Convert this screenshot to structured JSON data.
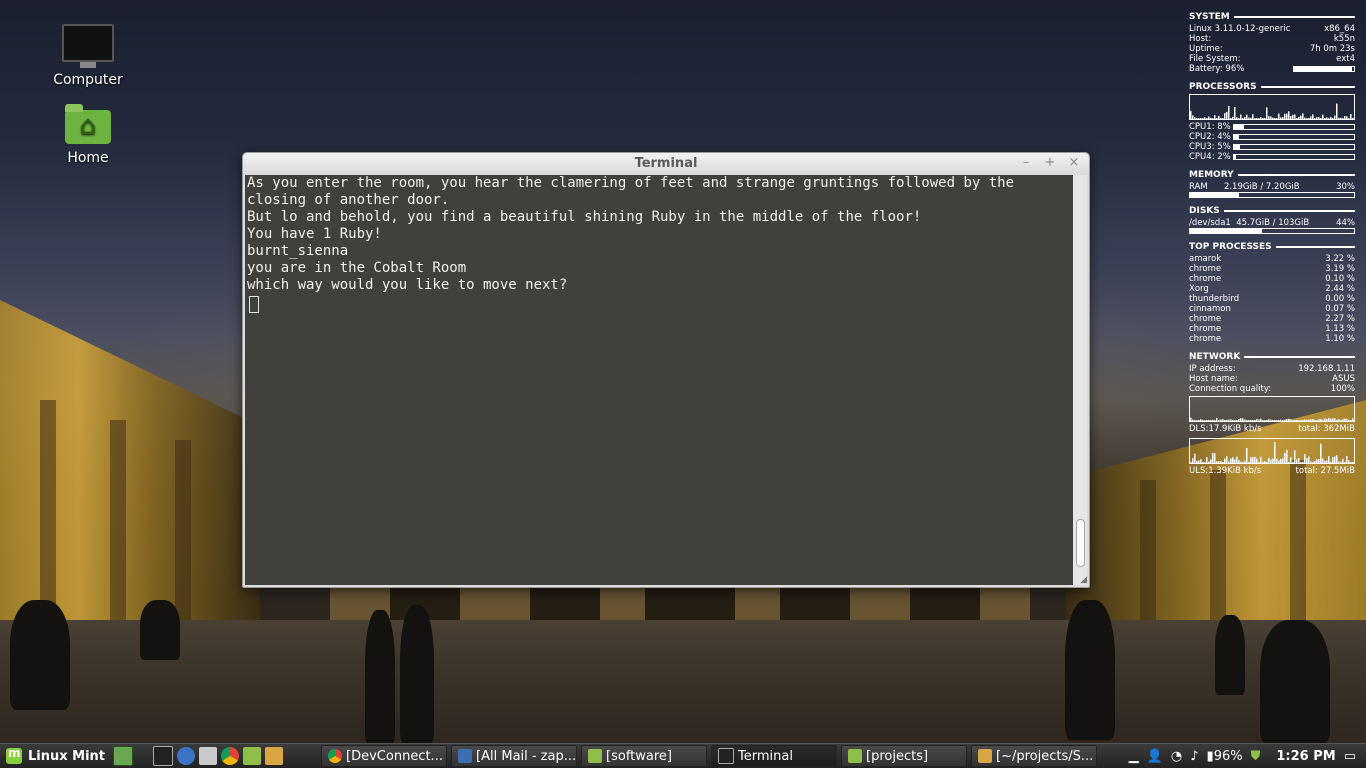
{
  "desktop": {
    "icons": [
      {
        "label": "Computer"
      },
      {
        "label": "Home"
      }
    ]
  },
  "terminal": {
    "title": "Terminal",
    "lines": [
      "As you enter the room, you hear the clamering of feet and strange gruntings followed by the closing of another door.",
      "But lo and behold, you find a beautiful shining Ruby in the middle of the floor!",
      "You have 1 Ruby!",
      "burnt_sienna",
      "you are in the Cobalt Room",
      "which way would you like to move next?"
    ]
  },
  "conky": {
    "system": {
      "heading": "SYSTEM",
      "kernel": "Linux 3.11.0-12-generic",
      "arch": "x86_64",
      "host_label": "Host:",
      "host": "k55n",
      "uptime_label": "Uptime:",
      "uptime": "7h 0m 23s",
      "fs_label": "File System:",
      "fs": "ext4",
      "battery_label": "Battery: 96%",
      "battery_fraction": 0.96
    },
    "processors": {
      "heading": "PROCESSORS",
      "cpus": [
        {
          "label": "CPU1: 8%",
          "fraction": 0.08
        },
        {
          "label": "CPU2: 4%",
          "fraction": 0.04
        },
        {
          "label": "CPU3: 5%",
          "fraction": 0.05
        },
        {
          "label": "CPU4: 2%",
          "fraction": 0.02
        }
      ]
    },
    "memory": {
      "heading": "MEMORY",
      "label": "RAM",
      "usage": "2.19GiB / 7.20GiB",
      "percent": "30%",
      "fraction": 0.3
    },
    "disks": {
      "heading": "DISKS",
      "label": "/dev/sda1",
      "usage": "45.7GiB / 103GiB",
      "percent": "44%",
      "fraction": 0.44
    },
    "top_processes": {
      "heading": "TOP PROCESSES",
      "rows": [
        {
          "name": "amarok",
          "cpu": "3.22 %"
        },
        {
          "name": "chrome",
          "cpu": "3.19 %"
        },
        {
          "name": "chrome",
          "cpu": "0.10 %"
        },
        {
          "name": "Xorg",
          "cpu": "2.44 %"
        },
        {
          "name": "thunderbird",
          "cpu": "0.00 %"
        },
        {
          "name": "cinnamon",
          "cpu": "0.07 %"
        },
        {
          "name": "chrome",
          "cpu": "2.27 %"
        },
        {
          "name": "chrome",
          "cpu": "1.13 %"
        },
        {
          "name": "chrome",
          "cpu": "1.10 %"
        }
      ]
    },
    "network": {
      "heading": "NETWORK",
      "ip_label": "IP address:",
      "ip": "192.168.1.11",
      "host_label": "Host name:",
      "host": "ASUS",
      "quality_label": "Connection quality:",
      "quality": "100%",
      "dl_label": "DLS:17.9KiB kb/s",
      "dl_total": "total: 362MiB",
      "ul_label": "ULS:1.39KiB kb/s",
      "ul_total": "total: 27.5MiB"
    }
  },
  "taskbar": {
    "menu_label": "Linux Mint",
    "tasks": [
      {
        "label": "[DevConnect...",
        "color": "#e04b3a"
      },
      {
        "label": "[All Mail - zap...",
        "color": "#3a6fb0"
      },
      {
        "label": "[software]",
        "color": "#8fbf4a"
      },
      {
        "label": "Terminal",
        "color": "#444444"
      },
      {
        "label": "[projects]",
        "color": "#8fbf4a"
      },
      {
        "label": "[~/projects/S...",
        "color": "#d9a545"
      }
    ],
    "battery": "96%",
    "clock": "1:26 PM"
  },
  "colors": {
    "mint_green": "#87cf3e",
    "terminal_bg": "#32322e"
  },
  "icons": [
    "computer-icon",
    "home-folder-icon",
    "mint-menu-icon",
    "terminal-icon",
    "browser-icon",
    "folder-icon",
    "volume-icon",
    "wifi-icon",
    "battery-icon",
    "shield-icon"
  ]
}
